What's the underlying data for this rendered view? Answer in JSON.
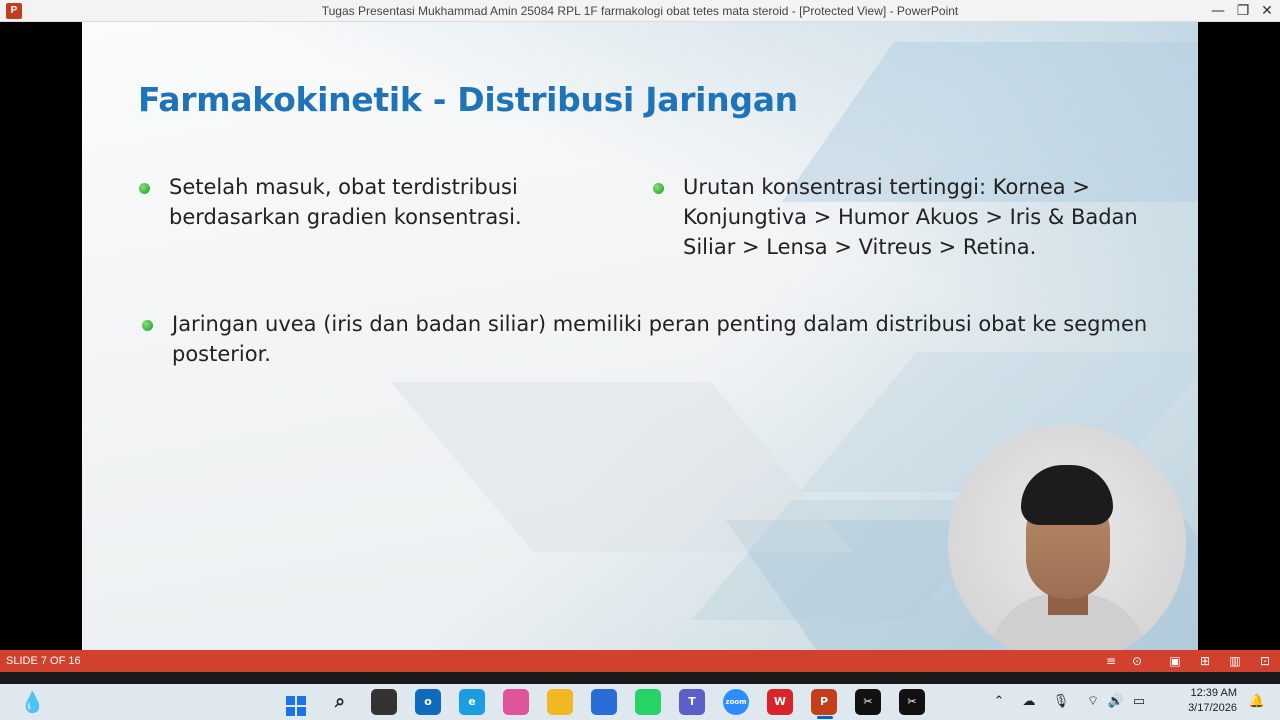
{
  "window": {
    "title": "Tugas Presentasi Mukhammad Amin 25084 RPL 1F farmakologi obat tetes mata steroid - [Protected View] - PowerPoint",
    "app_icon_label": "P",
    "minimize": "—",
    "restore": "❐",
    "close": "✕"
  },
  "slide": {
    "title": "Farmakokinetik - Distribusi Jaringan",
    "bullets": [
      "Setelah masuk, obat terdistribusi berdasarkan gradien konsentrasi.",
      "Urutan konsentrasi tertinggi: Kornea > Konjungtiva > Humor Akuos > Iris & Badan Siliar > Lensa > Vitreus > Retina.",
      "Jaringan uvea (iris dan badan siliar) memiliki peran penting dalam distribusi obat ke segmen posterior."
    ]
  },
  "statusbar": {
    "slide_info": "SLIDE 7 OF 16",
    "icons": [
      "notes-icon",
      "comments-icon",
      "present-icon",
      "normal-view-icon",
      "slide-sorter-icon",
      "reading-view-icon",
      "slideshow-icon"
    ]
  },
  "taskbar": {
    "apps": [
      {
        "name": "start",
        "label": "",
        "color": "#1a73e8"
      },
      {
        "name": "search",
        "label": "",
        "color": "#222222"
      },
      {
        "name": "task-view",
        "label": "",
        "color": "#333333"
      },
      {
        "name": "outlook",
        "label": "o",
        "color": "#0f6cbd"
      },
      {
        "name": "edge",
        "label": "e",
        "color": "#1b9de2"
      },
      {
        "name": "copilot",
        "label": "",
        "color": "#e0549b"
      },
      {
        "name": "file-explorer",
        "label": "",
        "color": "#f2b824"
      },
      {
        "name": "store",
        "label": "",
        "color": "#2a6dd6"
      },
      {
        "name": "whatsapp",
        "label": "",
        "color": "#25d366"
      },
      {
        "name": "teams",
        "label": "T",
        "color": "#5b5fc7"
      },
      {
        "name": "zoom",
        "label": "zoom",
        "color": "#2d8cff"
      },
      {
        "name": "wps",
        "label": "W",
        "color": "#d9252a"
      },
      {
        "name": "powerpoint",
        "label": "P",
        "color": "#c43e1c"
      },
      {
        "name": "capcut-1",
        "label": "✂",
        "color": "#111111"
      },
      {
        "name": "capcut-2",
        "label": "✂",
        "color": "#111111"
      }
    ],
    "clock_time": "12:39 AM",
    "clock_date": "3/17/2026"
  }
}
